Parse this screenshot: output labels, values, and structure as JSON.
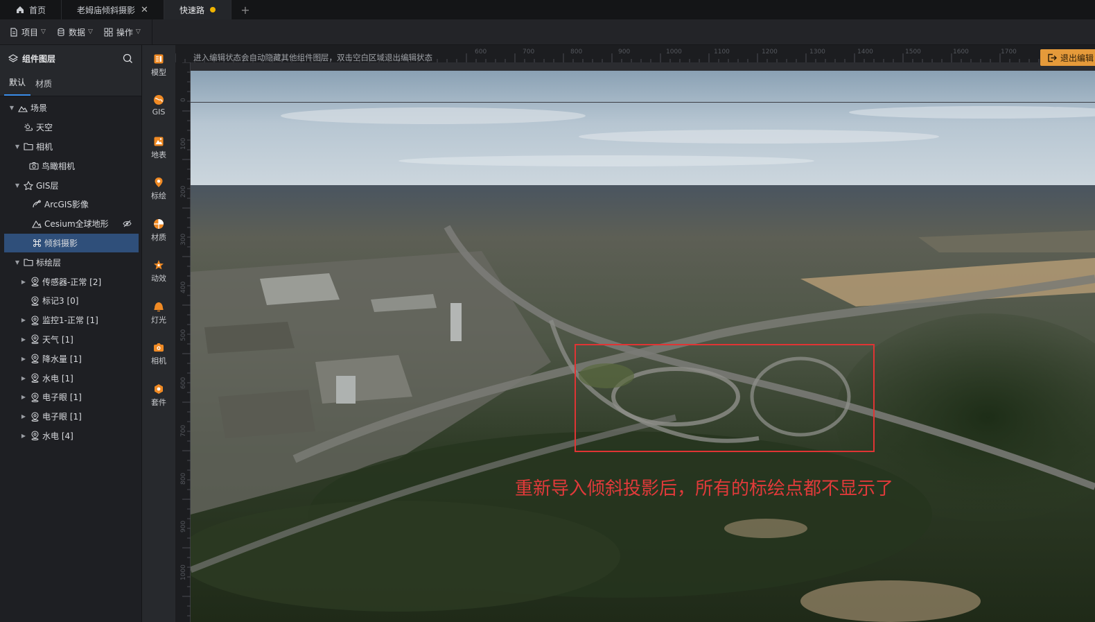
{
  "tabs": [
    {
      "label": "首页",
      "icon": "home-icon"
    },
    {
      "label": "老姆庙倾斜摄影",
      "close": "✕"
    },
    {
      "label": "快速路",
      "active": true,
      "unsaved_dot_color": "#f0b400"
    }
  ],
  "tab_add": "+",
  "toolbar": {
    "project": "项目",
    "data": "数据",
    "operation": "操作"
  },
  "panel": {
    "title": "组件图层",
    "subtabs": [
      "默认",
      "材质"
    ],
    "tree": [
      {
        "label": "场景",
        "icon": "landscape-icon",
        "arrow": "▼"
      },
      {
        "label": "天空",
        "icon": "sky-icon"
      },
      {
        "label": "相机",
        "icon": "folder-icon",
        "arrow": "▼"
      },
      {
        "label": "鸟瞰相机",
        "icon": "camera-icon"
      },
      {
        "label": "GIS层",
        "icon": "gis-layer-icon",
        "arrow": "▼"
      },
      {
        "label": "ArcGIS影像",
        "icon": "satellite-icon"
      },
      {
        "label": "Cesium全球地形",
        "icon": "terrain-icon"
      },
      {
        "label": "倾斜摄影",
        "icon": "command-icon",
        "selected": true
      },
      {
        "label": "标绘层",
        "icon": "folder-icon",
        "arrow": "▼"
      },
      {
        "label": "传感器-正常 [2]",
        "icon": "pin-icon",
        "arrow": "▶"
      },
      {
        "label": "标记3 [0]",
        "icon": "pin-icon"
      },
      {
        "label": "监控1-正常 [1]",
        "icon": "pin-icon",
        "arrow": "▶"
      },
      {
        "label": "天气 [1]",
        "icon": "pin-icon",
        "arrow": "▶"
      },
      {
        "label": "降水量 [1]",
        "icon": "pin-icon",
        "arrow": "▶"
      },
      {
        "label": "水电 [1]",
        "icon": "pin-icon",
        "arrow": "▶"
      },
      {
        "label": "电子眼 [1]",
        "icon": "pin-icon",
        "arrow": "▶"
      },
      {
        "label": "电子眼 [1]",
        "icon": "pin-icon",
        "arrow": "▶"
      },
      {
        "label": "水电 [4]",
        "icon": "pin-icon",
        "arrow": "▶"
      }
    ]
  },
  "iconbar": [
    {
      "label": "模型",
      "icon": "model-icon"
    },
    {
      "label": "GIS",
      "icon": "globe-icon"
    },
    {
      "label": "地表",
      "icon": "surface-icon"
    },
    {
      "label": "标绘",
      "icon": "marker-icon"
    },
    {
      "label": "材质",
      "icon": "material-icon"
    },
    {
      "label": "动效",
      "icon": "effect-icon"
    },
    {
      "label": "灯光",
      "icon": "light-icon"
    },
    {
      "label": "相机",
      "icon": "camera-icon"
    },
    {
      "label": "套件",
      "icon": "kit-icon"
    }
  ],
  "viewport": {
    "hint": "进入编辑状态会自动隐藏其他组件图层，双击空白区域退出编辑状态",
    "exit_button": "退出编辑",
    "ruler_top": [
      "600",
      "700",
      "800",
      "900",
      "1000",
      "1100",
      "1200",
      "1300",
      "1400",
      "1500",
      "1600",
      "1700"
    ],
    "ruler_left": [
      "0",
      "100",
      "200",
      "300",
      "400",
      "500",
      "600",
      "700",
      "800",
      "900",
      "1000"
    ],
    "annotation": "重新导入倾斜投影后，所有的标绘点都不显示了"
  },
  "colors": {
    "accent": "#3b8eea",
    "selected_row": "#2f4f7a",
    "icon_orange": "#f08a24",
    "exit_button": "#e59a3a",
    "annotation_red": "#e03434"
  }
}
